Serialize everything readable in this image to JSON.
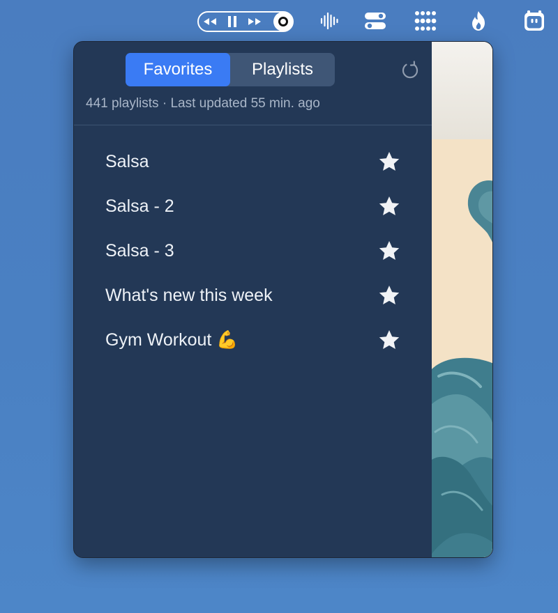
{
  "menubar": {
    "media_controls": {
      "rewind_icon": "rewind-icon",
      "pause_icon": "pause-icon",
      "forward_icon": "fast-forward-icon",
      "record_icon": "record-icon"
    },
    "icons": [
      "audio-waveform-icon",
      "toggle-switches-icon",
      "dot-grid-icon",
      "flame-icon",
      "robot-face-icon"
    ]
  },
  "popover": {
    "tabs": [
      {
        "label": "Favorites",
        "active": true
      },
      {
        "label": "Playlists",
        "active": false
      }
    ],
    "refresh_icon": "refresh-icon",
    "subtitle": "441 playlists · Last updated 55 min. ago",
    "playlists": [
      {
        "label": "Salsa",
        "favorite": true
      },
      {
        "label": "Salsa - 2",
        "favorite": true
      },
      {
        "label": "Salsa - 3",
        "favorite": true
      },
      {
        "label": "What's new this week",
        "favorite": true
      },
      {
        "label": "Gym Workout 💪",
        "favorite": true
      }
    ]
  },
  "colors": {
    "desktop": "#4a80c2",
    "panel": "#233856",
    "accent": "#3a7bf4",
    "segmented_bg": "#3f5676",
    "artwork_bg": "#f3e1c6",
    "artwork_blob": "#3f7f8f"
  }
}
